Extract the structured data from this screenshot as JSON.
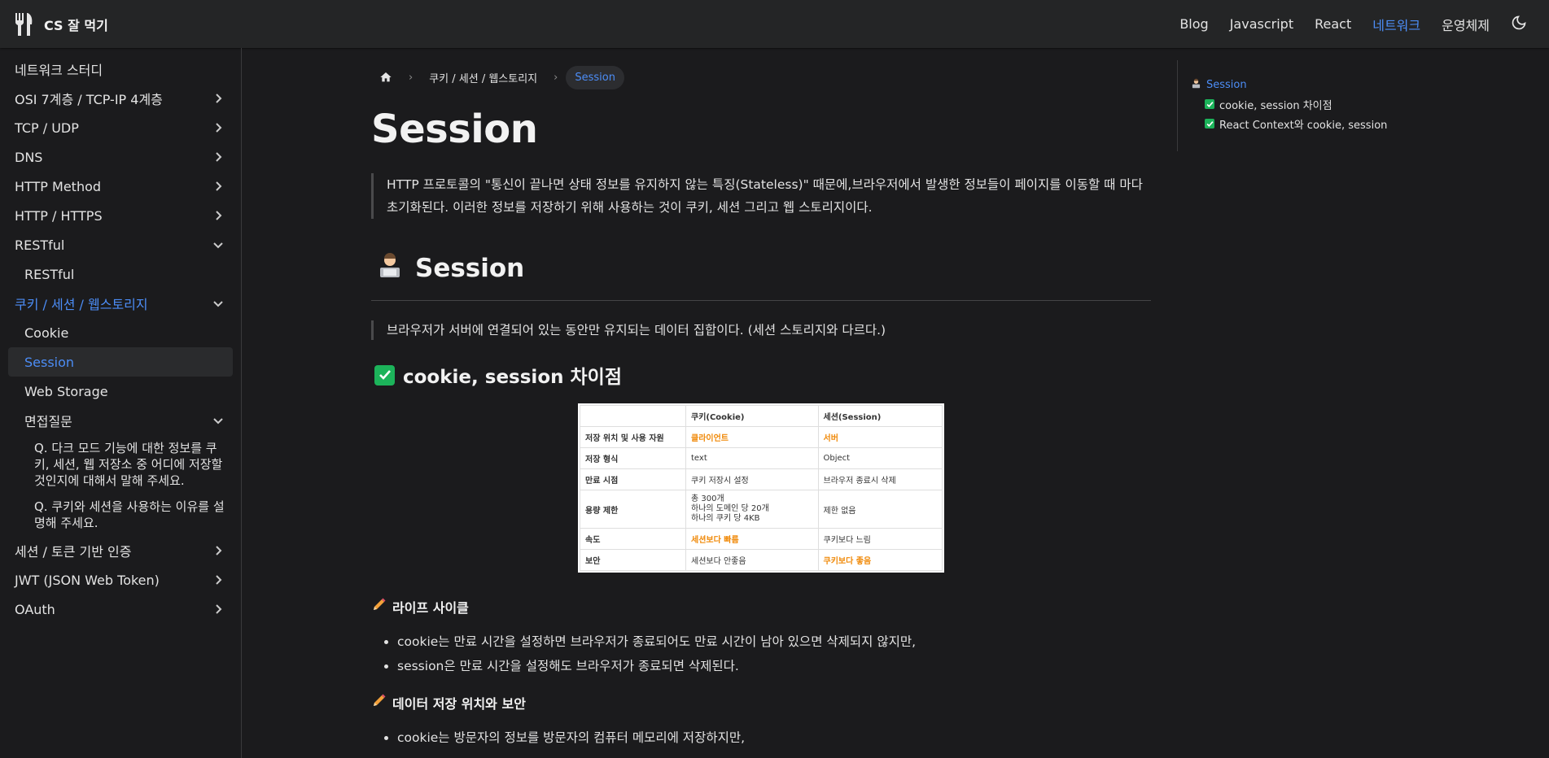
{
  "navbar": {
    "title": "CS 잘 먹기",
    "links": [
      "Blog",
      "Javascript",
      "React",
      "네트워크",
      "운영체제"
    ],
    "active_link": "네트워크",
    "theme_icon": "moon-icon"
  },
  "sidebar": {
    "items": [
      {
        "label": "네트워크 스터디"
      },
      {
        "label": "OSI 7계층 / TCP-IP 4계층"
      },
      {
        "label": "TCP / UDP"
      },
      {
        "label": "DNS"
      },
      {
        "label": "HTTP Method"
      },
      {
        "label": "HTTP / HTTPS"
      },
      {
        "label": "RESTful"
      },
      {
        "label": "RESTful"
      },
      {
        "label": "쿠키 / 세션 / 웹스토리지"
      },
      {
        "label": "Cookie"
      },
      {
        "label": "Session"
      },
      {
        "label": "Web Storage"
      },
      {
        "label": "면접질문"
      },
      {
        "label": "Q. 다크 모드 기능에 대한 정보를 쿠키, 세션, 웹 저장소 중 어디에 저장할 것인지에 대해서 말해 주세요."
      },
      {
        "label": "Q. 쿠키와 세션을 사용하는 이유를 설명해 주세요."
      },
      {
        "label": "세션 / 토큰 기반 인증"
      },
      {
        "label": "JWT (JSON Web Token)"
      },
      {
        "label": "OAuth"
      }
    ]
  },
  "breadcrumb": {
    "parent": "쿠키 / 세션 / 웹스토리지",
    "current": "Session"
  },
  "doc": {
    "title": "Session",
    "intro": "HTTP 프로토콜의 \"통신이 끝나면 상태 정보를 유지하지 않는 특징(Stateless)\" 때문에,브라우저에서 발생한 정보들이 페이지를 이동할 때 마다 초기화된다. 이러한 정보를 저장하기 위해 사용하는 것이 쿠키, 세션 그리고 웹 스토리지이다.",
    "section_title": "Session",
    "section_quote": "브라우저가 서버에 연결되어 있는 동안만 유지되는 데이터 집합이다. (세션 스토리지와 다르다.)",
    "subsection_title": "cookie, session 차이점",
    "table": {
      "headers": [
        "",
        "쿠키(Cookie)",
        "세션(Session)"
      ],
      "rows": [
        [
          "저장 위치 및 사용 자원",
          "클라이언트",
          "서버"
        ],
        [
          "저장 형식",
          "text",
          "Object"
        ],
        [
          "만료 시점",
          "쿠키 저장시 설정",
          "브라우저 종료시 삭제"
        ],
        [
          "용량 제한",
          "총 300개\n하나의 도메인 당 20개\n하나의 쿠키 당 4KB",
          "제한 없음"
        ],
        [
          "속도",
          "세션보다 빠름",
          "쿠키보다 느림"
        ],
        [
          "보안",
          "세션보다 안좋음",
          "쿠키보다 좋음"
        ]
      ]
    },
    "lifecycle_title": "라이프 사이클",
    "lifecycle_points": [
      "cookie는 만료 시간을 설정하면 브라우저가 종료되어도 만료 시간이 남아 있으면 삭제되지 않지만,",
      "session은 만료 시간을 설정해도 브라우저가 종료되면 삭제된다."
    ],
    "storage_title": "데이터 저장 위치와 보안",
    "storage_points": [
      "cookie는 방문자의 정보를 방문자의 컴퓨터 메모리에 저장하지만,"
    ]
  },
  "toc": {
    "items": [
      "Session",
      "cookie, session 차이점",
      "React Context와 cookie, session"
    ]
  },
  "colors": {
    "accent": "#4c8df6",
    "check": "#1cb35a",
    "highlight": "#f08a0a"
  }
}
